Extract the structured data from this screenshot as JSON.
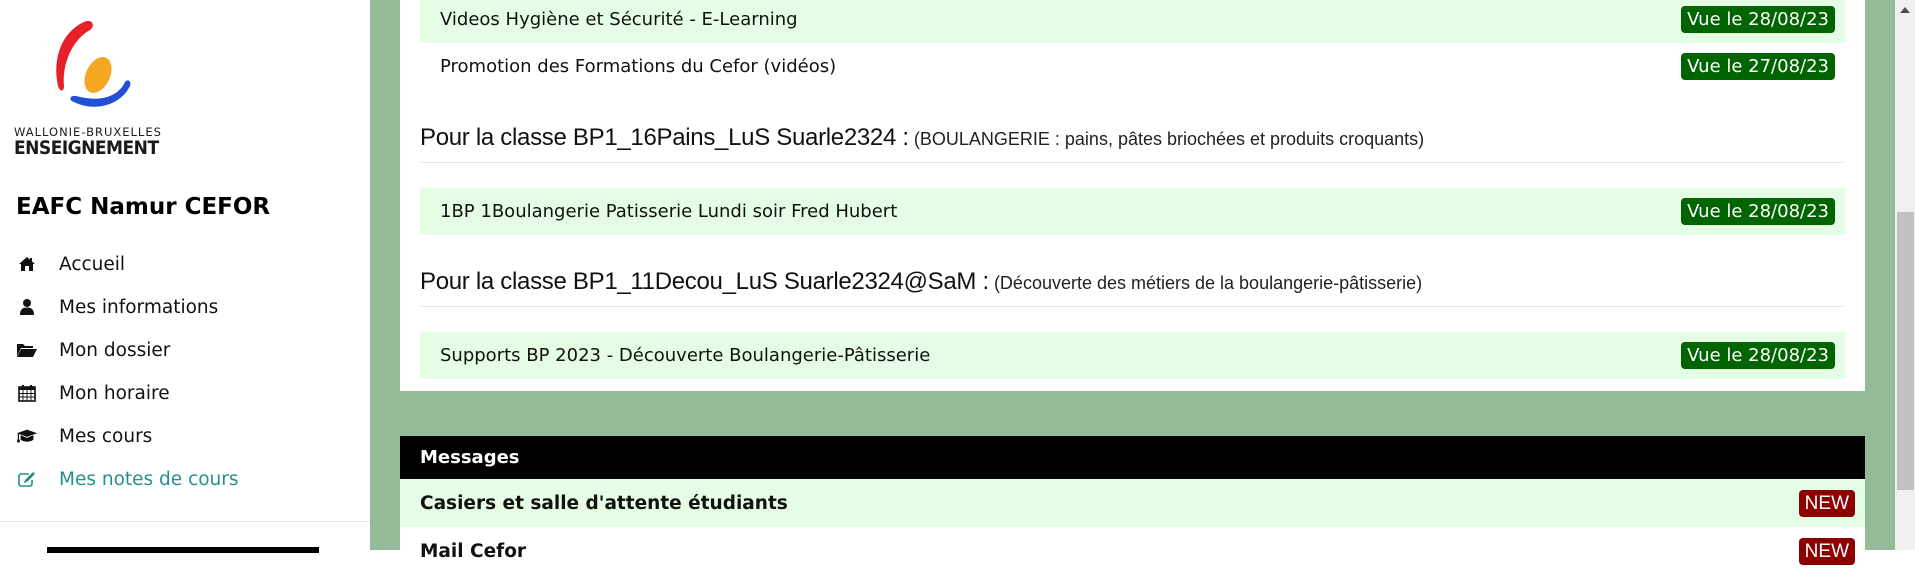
{
  "brand": {
    "logo_line1": "WALLONIE-BRUXELLES",
    "logo_line2": "ENSEIGNEMENT",
    "school_name": "EAFC Namur CEFOR"
  },
  "sidebar": {
    "items": [
      {
        "label": "Accueil",
        "icon": "home-icon"
      },
      {
        "label": "Mes informations",
        "icon": "user-icon"
      },
      {
        "label": "Mon dossier",
        "icon": "folder-open-icon"
      },
      {
        "label": "Mon horaire",
        "icon": "calendar-icon"
      },
      {
        "label": "Mes cours",
        "icon": "graduation-cap-icon"
      },
      {
        "label": "Mes notes de cours",
        "icon": "edit-icon",
        "active": true
      }
    ]
  },
  "courses": {
    "top_items": [
      {
        "title": "Videos Hygiène et Sécurité - E-Learning",
        "seen": "Vue le 28/08/23"
      },
      {
        "title": "Promotion des Formations du Cefor (vidéos)",
        "seen": "Vue le 27/08/23"
      }
    ],
    "classes": [
      {
        "heading": "Pour la classe BP1_16Pains_LuS Suarle2324 :",
        "subheading": "(BOULANGERIE : pains, pâtes briochées et produits croquants)",
        "items": [
          {
            "title": "1BP 1Boulangerie Patisserie Lundi soir Fred Hubert",
            "seen": "Vue le 28/08/23"
          }
        ]
      },
      {
        "heading": "Pour la classe BP1_11Decou_LuS Suarle2324@SaM :",
        "subheading": "(Découverte des métiers de la boulangerie-pâtisserie)",
        "items": [
          {
            "title": "Supports BP 2023 - Découverte Boulangerie-Pâtisserie",
            "seen": "Vue le 28/08/23"
          }
        ]
      }
    ]
  },
  "messages": {
    "header": "Messages",
    "items": [
      {
        "title": "Casiers et salle d'attente étudiants",
        "badge": "NEW"
      },
      {
        "title": "Mail Cefor",
        "badge": "NEW"
      }
    ]
  },
  "colors": {
    "page_green": "#94bb98",
    "row_tint": "#e5fde5",
    "seen_badge": "#006400",
    "new_badge": "#8b0000",
    "active_nav": "#23918a"
  }
}
